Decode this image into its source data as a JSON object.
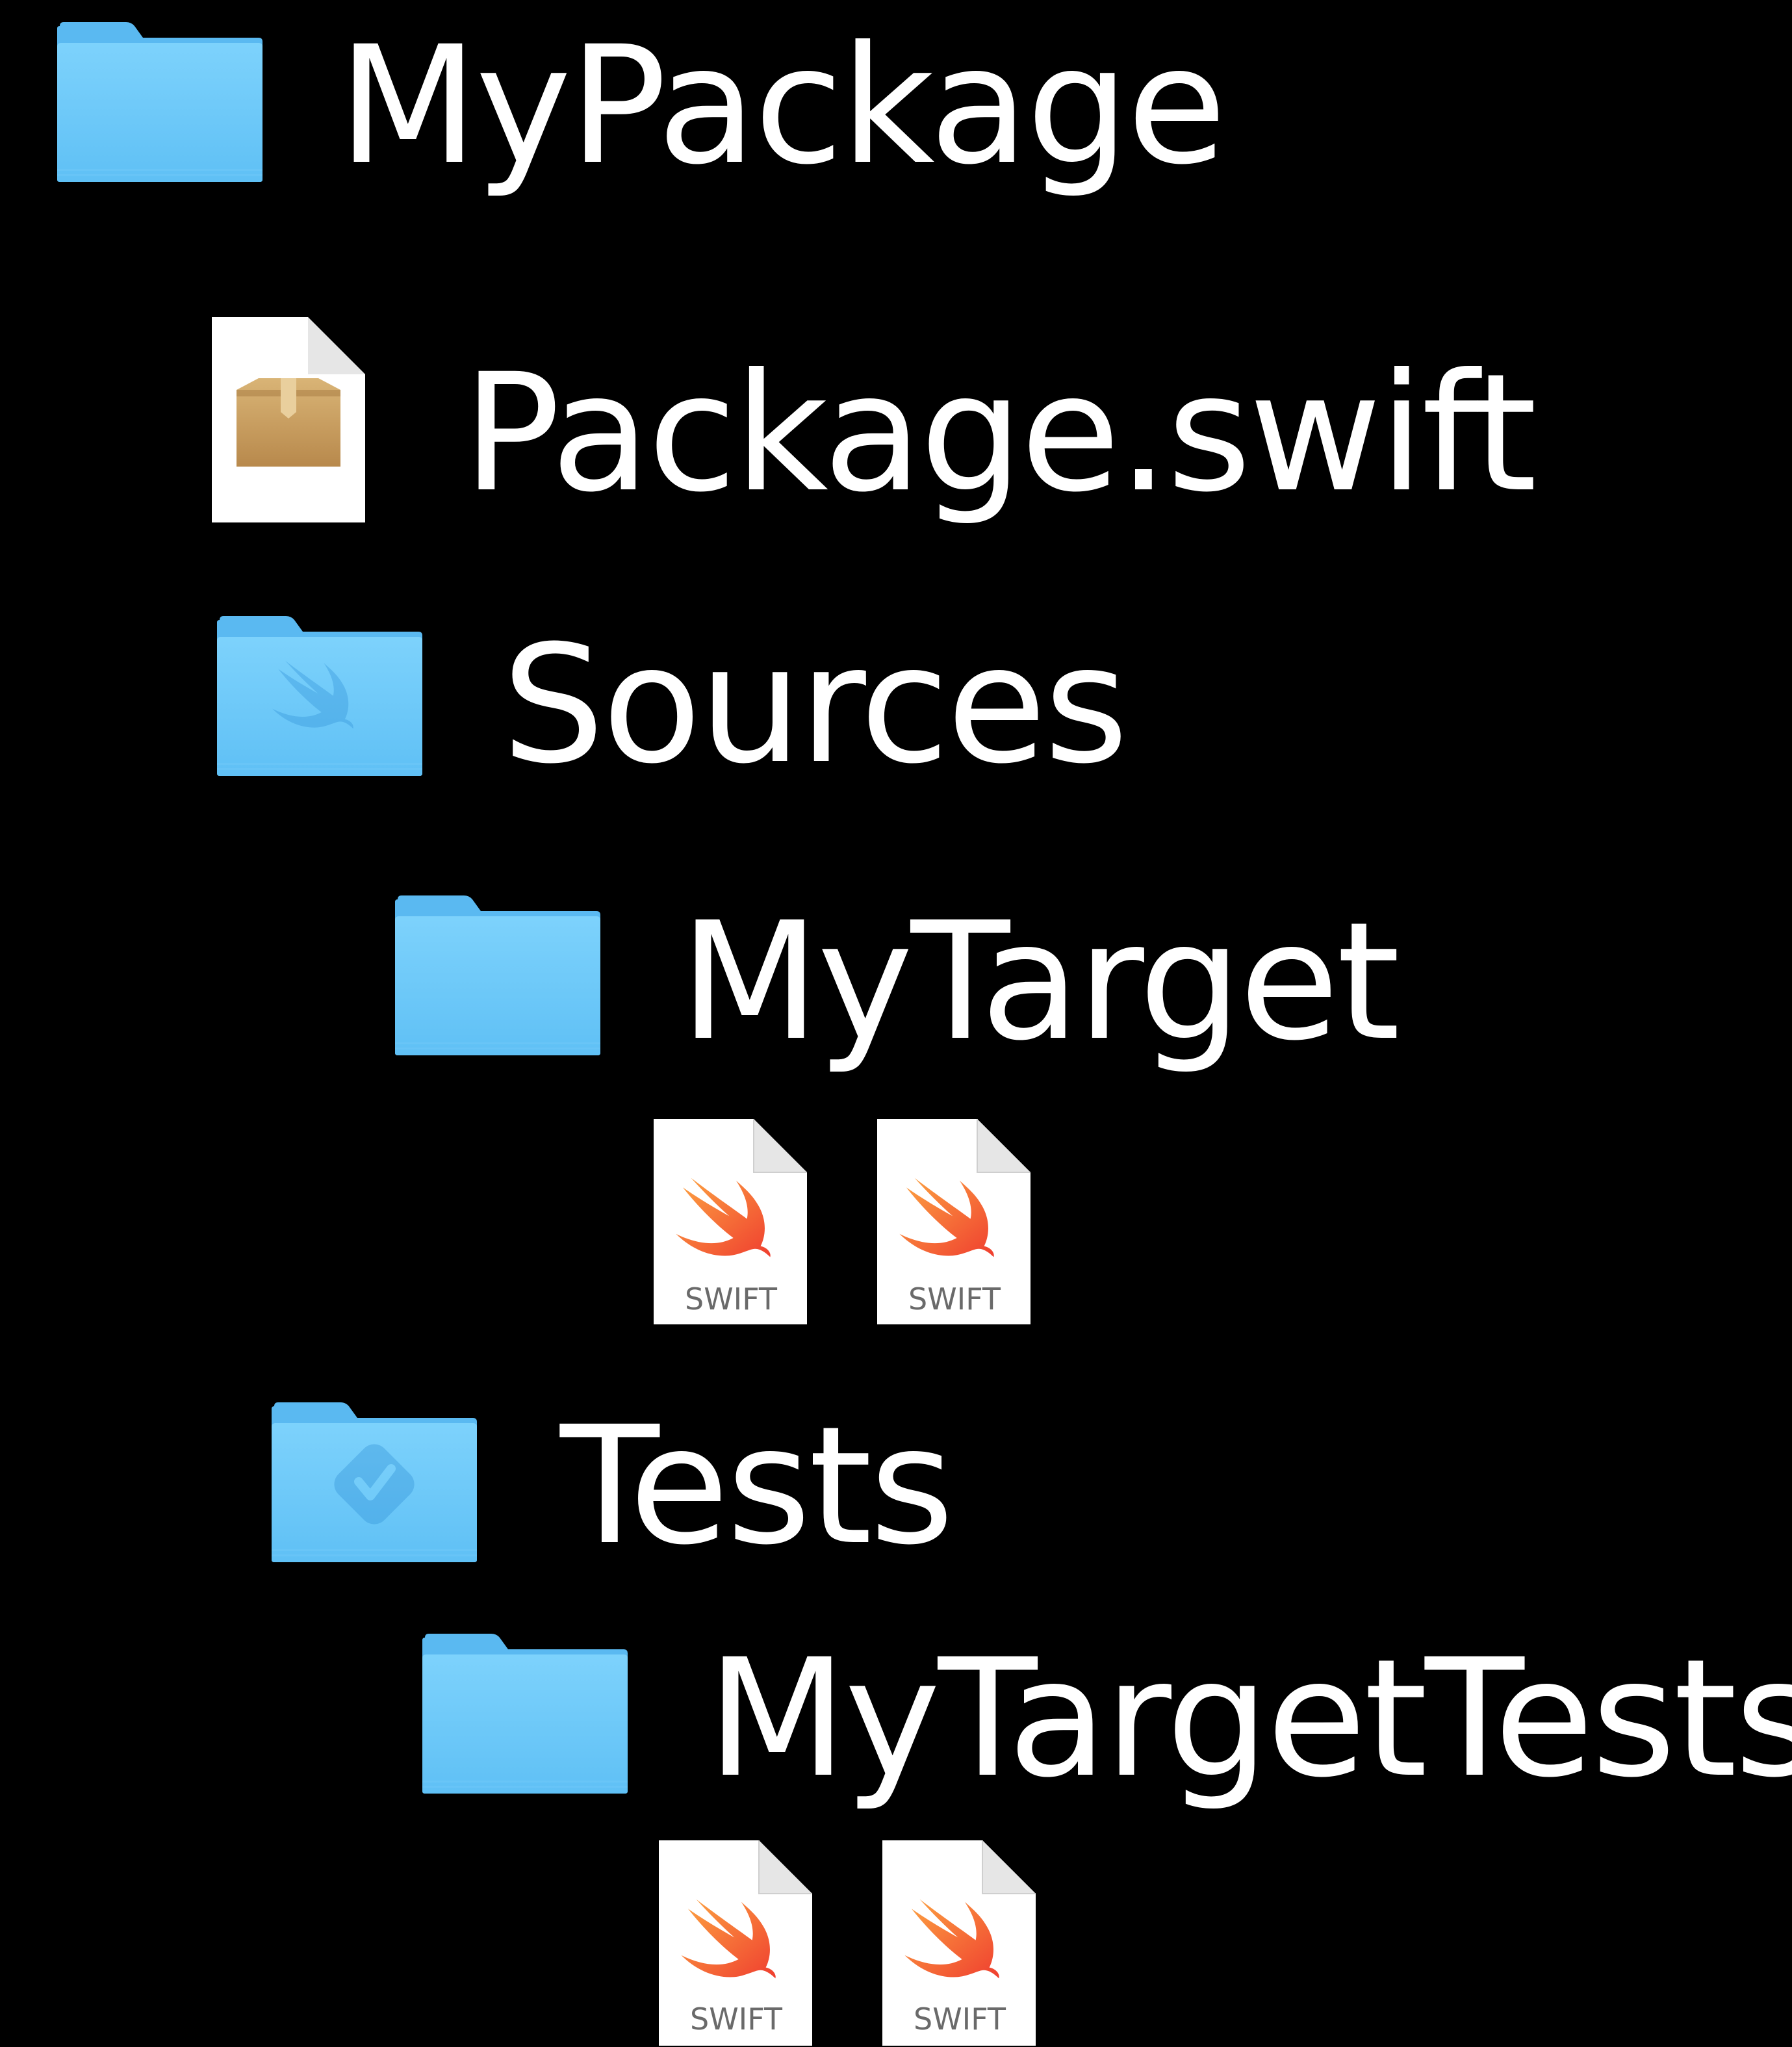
{
  "tree": {
    "root": {
      "name": "MyPackage",
      "icon": "folder-icon"
    },
    "manifest": {
      "name": "Package.swift",
      "icon": "package-manifest-file-icon"
    },
    "sources": {
      "name": "Sources",
      "icon": "swift-sources-folder-icon"
    },
    "target": {
      "name": "MyTarget",
      "icon": "folder-icon",
      "files": [
        {
          "icon": "swift-file-icon",
          "badge": "SWIFT"
        },
        {
          "icon": "swift-file-icon",
          "badge": "SWIFT"
        }
      ]
    },
    "tests": {
      "name": "Tests",
      "icon": "tests-folder-icon"
    },
    "test_target": {
      "name": "MyTargetTests",
      "icon": "folder-icon",
      "files": [
        {
          "icon": "swift-file-icon",
          "badge": "SWIFT"
        },
        {
          "icon": "swift-file-icon",
          "badge": "SWIFT"
        }
      ]
    }
  },
  "colors": {
    "background": "#000000",
    "text": "#ffffff",
    "folder_light": "#7cd1fb",
    "folder_dark": "#5bbcf3",
    "swift_orange": "#f05138",
    "package_box": "#c9a063"
  }
}
